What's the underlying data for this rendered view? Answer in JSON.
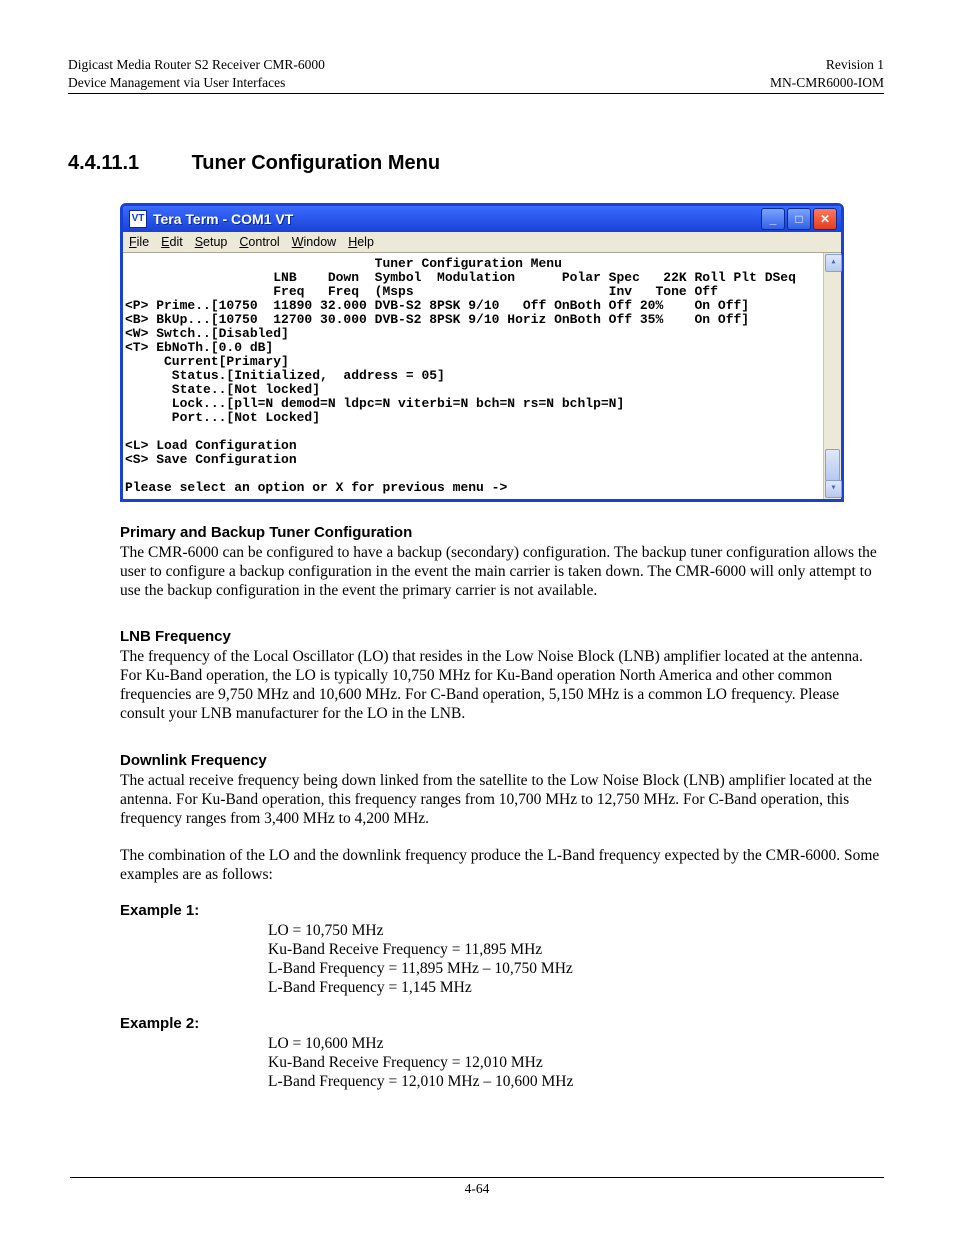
{
  "header": {
    "left1": "Digicast Media Router S2 Receiver CMR-6000",
    "left2": "Device Management via User Interfaces",
    "right1": "Revision 1",
    "right2": "MN-CMR6000-IOM"
  },
  "section": {
    "number": "4.4.11.1",
    "title": "Tuner Configuration Menu"
  },
  "teraterm": {
    "appicon": "VT",
    "title": "Tera Term - COM1 VT",
    "menus": {
      "file": "File",
      "edit": "Edit",
      "setup": "Setup",
      "control": "Control",
      "window": "Window",
      "help": "Help"
    },
    "scroll": {
      "up": "▴",
      "down": "▾"
    },
    "content": "                                Tuner Configuration Menu\n                   LNB    Down  Symbol  Modulation      Polar Spec   22K Roll Plt DSeq\n                   Freq   Freq  (Msps                         Inv   Tone Off\n<P> Prime..[10750  11890 32.000 DVB-S2 8PSK 9/10   Off OnBoth Off 20%    On Off]\n<B> BkUp...[10750  12700 30.000 DVB-S2 8PSK 9/10 Horiz OnBoth Off 35%    On Off]\n<W> Swtch..[Disabled]\n<T> EbNoTh.[0.0 dB]\n     Current[Primary]\n      Status.[Initialized,  address = 05]\n      State..[Not locked]\n      Lock...[pll=N demod=N ldpc=N viterbi=N bch=N rs=N bchlp=N]\n      Port...[Not Locked]\n\n<L> Load Configuration\n<S> Save Configuration\n\nPlease select an option or X for previous menu ->"
  },
  "content": {
    "primary_head": "Primary and Backup Tuner Configuration",
    "primary_text": "The CMR-6000 can be configured to have a backup (secondary) configuration.  The backup tuner configuration allows the user to configure a backup configuration in the event the main carrier is taken down.  The CMR-6000 will only attempt to use the backup configuration in the event the primary carrier is not available.",
    "lnb_head": "LNB Frequency",
    "lnb_text": "The frequency of the Local Oscillator (LO) that resides in the Low Noise Block (LNB) amplifier located at the antenna.  For Ku-Band operation, the LO is typically 10,750 MHz for Ku-Band operation North America and other common frequencies are 9,750 MHz and 10,600 MHz.  For C-Band operation, 5,150 MHz is a common LO frequency.  Please consult your LNB manufacturer for the LO in the LNB.",
    "down_head": "Downlink Frequency",
    "down_text": "The actual receive frequency being down linked from the satellite to the Low Noise Block (LNB) amplifier located at the antenna.  For Ku-Band operation, this frequency ranges from 10,700 MHz to 12,750 MHz.  For C-Band operation, this frequency ranges from 3,400 MHz to 4,200 MHz.",
    "combo_text": "The combination of the LO and the downlink frequency produce the L-Band frequency expected by the CMR-6000. Some examples are as follows:",
    "ex1_label": "Example 1:",
    "ex1_l1": "LO = 10,750 MHz",
    "ex1_l2": "Ku-Band Receive Frequency = 11,895 MHz",
    "ex1_l3": "L-Band Frequency = 11,895 MHz – 10,750 MHz",
    "ex1_l4": "L-Band Frequency = 1,145 MHz",
    "ex2_label": "Example 2:",
    "ex2_l1": "LO = 10,600 MHz",
    "ex2_l2": "Ku-Band Receive Frequency = 12,010 MHz",
    "ex2_l3": "L-Band Frequency = 12,010 MHz – 10,600 MHz"
  },
  "footer": {
    "pagenum": "4-64"
  }
}
